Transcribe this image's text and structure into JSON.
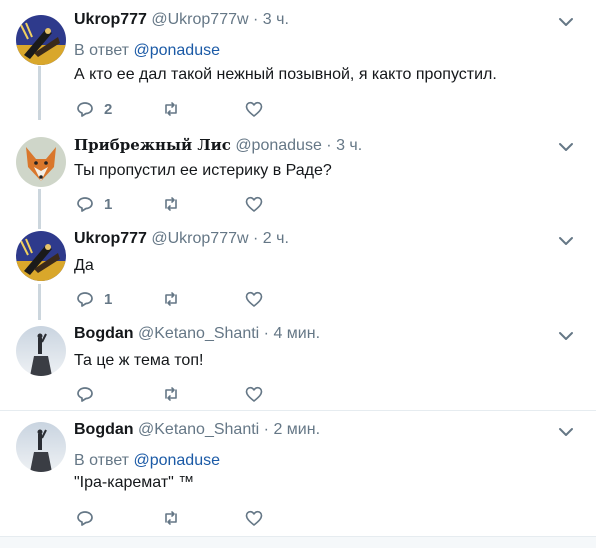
{
  "tweets": [
    {
      "name": "Ukrop777",
      "handle": "@Ukrop777w",
      "dot": "·",
      "time": "3 ч.",
      "reply_prefix": "В ответ",
      "reply_to": "@ponaduse",
      "text": "А кто ее дал такой нежный позывной, я както пропустил.",
      "reply_count": "2",
      "avatar": "ukrop-avatar"
    },
    {
      "name": "Прибрежный Лис",
      "handle": "@ponaduse",
      "dot": "·",
      "time": "3 ч.",
      "text": "Ты пропустил ее истерику в Раде?",
      "reply_count": "1",
      "avatar": "fox-avatar"
    },
    {
      "name": "Ukrop777",
      "handle": "@Ukrop777w",
      "dot": "·",
      "time": "2 ч.",
      "text": "Да",
      "reply_count": "1",
      "avatar": "ukrop-avatar"
    },
    {
      "name": "Bogdan",
      "handle": "@Ketano_Shanti",
      "dot": "·",
      "time": "4 мин.",
      "text": "Та це ж тема топ!",
      "avatar": "statue-avatar"
    },
    {
      "name": "Bogdan",
      "handle": "@Ketano_Shanti",
      "dot": "·",
      "time": "2 мин.",
      "reply_prefix": "В ответ",
      "reply_to": "@ponaduse",
      "text": "\"Іра-каремат\" ™",
      "avatar": "statue-avatar"
    }
  ],
  "colors": {
    "link": "#1b5aa6",
    "secondary_text": "#657786",
    "thread_line": "#ccd6dd"
  },
  "icons": [
    "reply-icon",
    "retweet-icon",
    "like-icon",
    "chevron-down-icon"
  ]
}
